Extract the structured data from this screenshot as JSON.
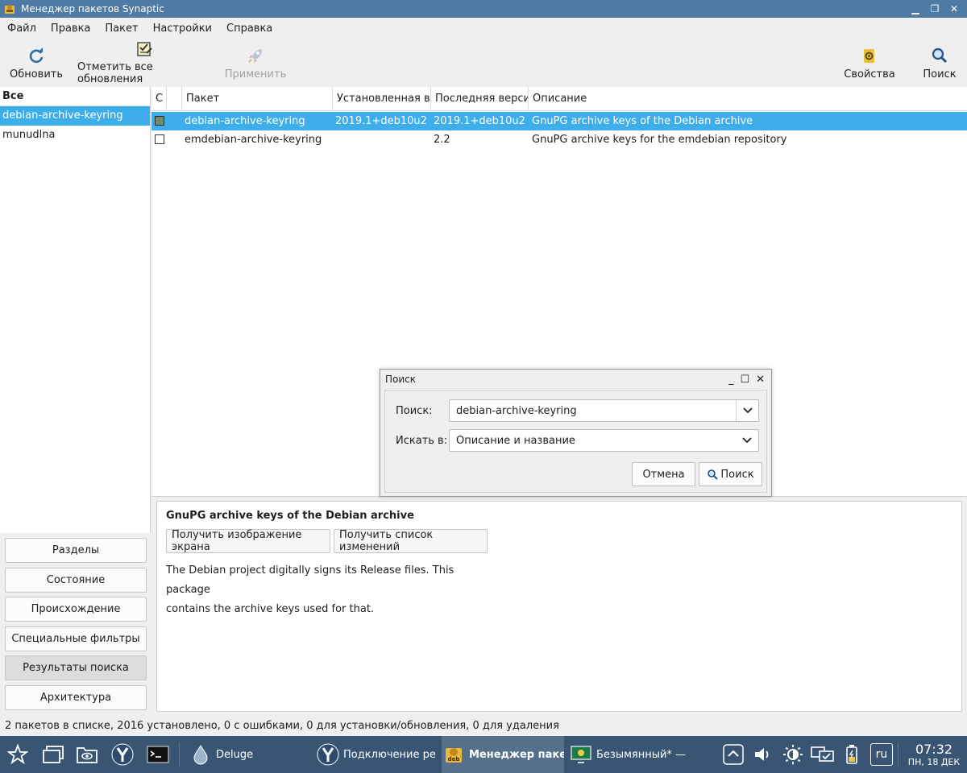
{
  "window": {
    "title": "Менеджер пакетов Synaptic",
    "app_icon": "synaptic-icon"
  },
  "menu": [
    "Файл",
    "Правка",
    "Пакет",
    "Настройки",
    "Справка"
  ],
  "toolbar": {
    "reload": "Обновить",
    "mark_all": "Отметить все обновления",
    "apply": "Применить",
    "properties": "Свойства",
    "search": "Поиск"
  },
  "filter_list": {
    "header": "Все",
    "items": [
      "debian-archive-keyring",
      "munudlna"
    ],
    "selected": "debian-archive-keyring"
  },
  "filter_buttons": [
    "Разделы",
    "Состояние",
    "Происхождение",
    "Специальные фильтры",
    "Результаты поиска",
    "Архитектура"
  ],
  "active_filter": "Результаты поиска",
  "columns": [
    "С",
    "",
    "Пакет",
    "Установленная вер",
    "Последняя версия",
    "Описание"
  ],
  "packages": [
    {
      "name": "debian-archive-keyring",
      "installed": "2019.1+deb10u2",
      "latest": "2019.1+deb10u2",
      "description": "GnuPG archive keys of the Debian archive",
      "status": "installed",
      "selected": true
    },
    {
      "name": "emdebian-archive-keyring",
      "installed": "",
      "latest": "2.2",
      "description": "GnuPG archive keys for the emdebian repository",
      "status": "not-installed",
      "selected": false
    }
  ],
  "details": {
    "title": "GnuPG archive keys of the Debian archive",
    "screenshot_btn": "Получить изображение экрана",
    "changelog_btn": "Получить список изменений",
    "text_line1": "The Debian project digitally signs its Release files. This package",
    "text_line2": "contains the archive keys used for that."
  },
  "status_text": "2 пакетов в списке, 2016 установлено, 0 с ошибками, 0 для установки/обновления, 0 для удаления",
  "search_dialog": {
    "title": "Поиск",
    "search_label": "Поиск:",
    "search_value": "debian-archive-keyring",
    "look_in_label": "Искать в:",
    "look_in_value": "Описание и название",
    "cancel": "Отмена",
    "search_btn": "Поиск"
  },
  "taskbar": {
    "tasks": [
      {
        "label": "Deluge",
        "icon": "deluge-icon"
      },
      {
        "label": "Подключение ре...",
        "icon": "yandex-browser-icon"
      },
      {
        "label": "Менеджер паке...",
        "icon": "synaptic-icon",
        "active": true
      },
      {
        "label": "Безымянный* — ...",
        "icon": "display-icon"
      }
    ],
    "keyboard_layout": "ru",
    "clock_time": "07:32",
    "clock_date": "ПН, 18 ДЕК"
  },
  "colors": {
    "selection": "#3daee9",
    "titlebar": "#4f7aa6",
    "taskbar": "#3a5573",
    "installed_checkbox": "#6f8d6a"
  }
}
